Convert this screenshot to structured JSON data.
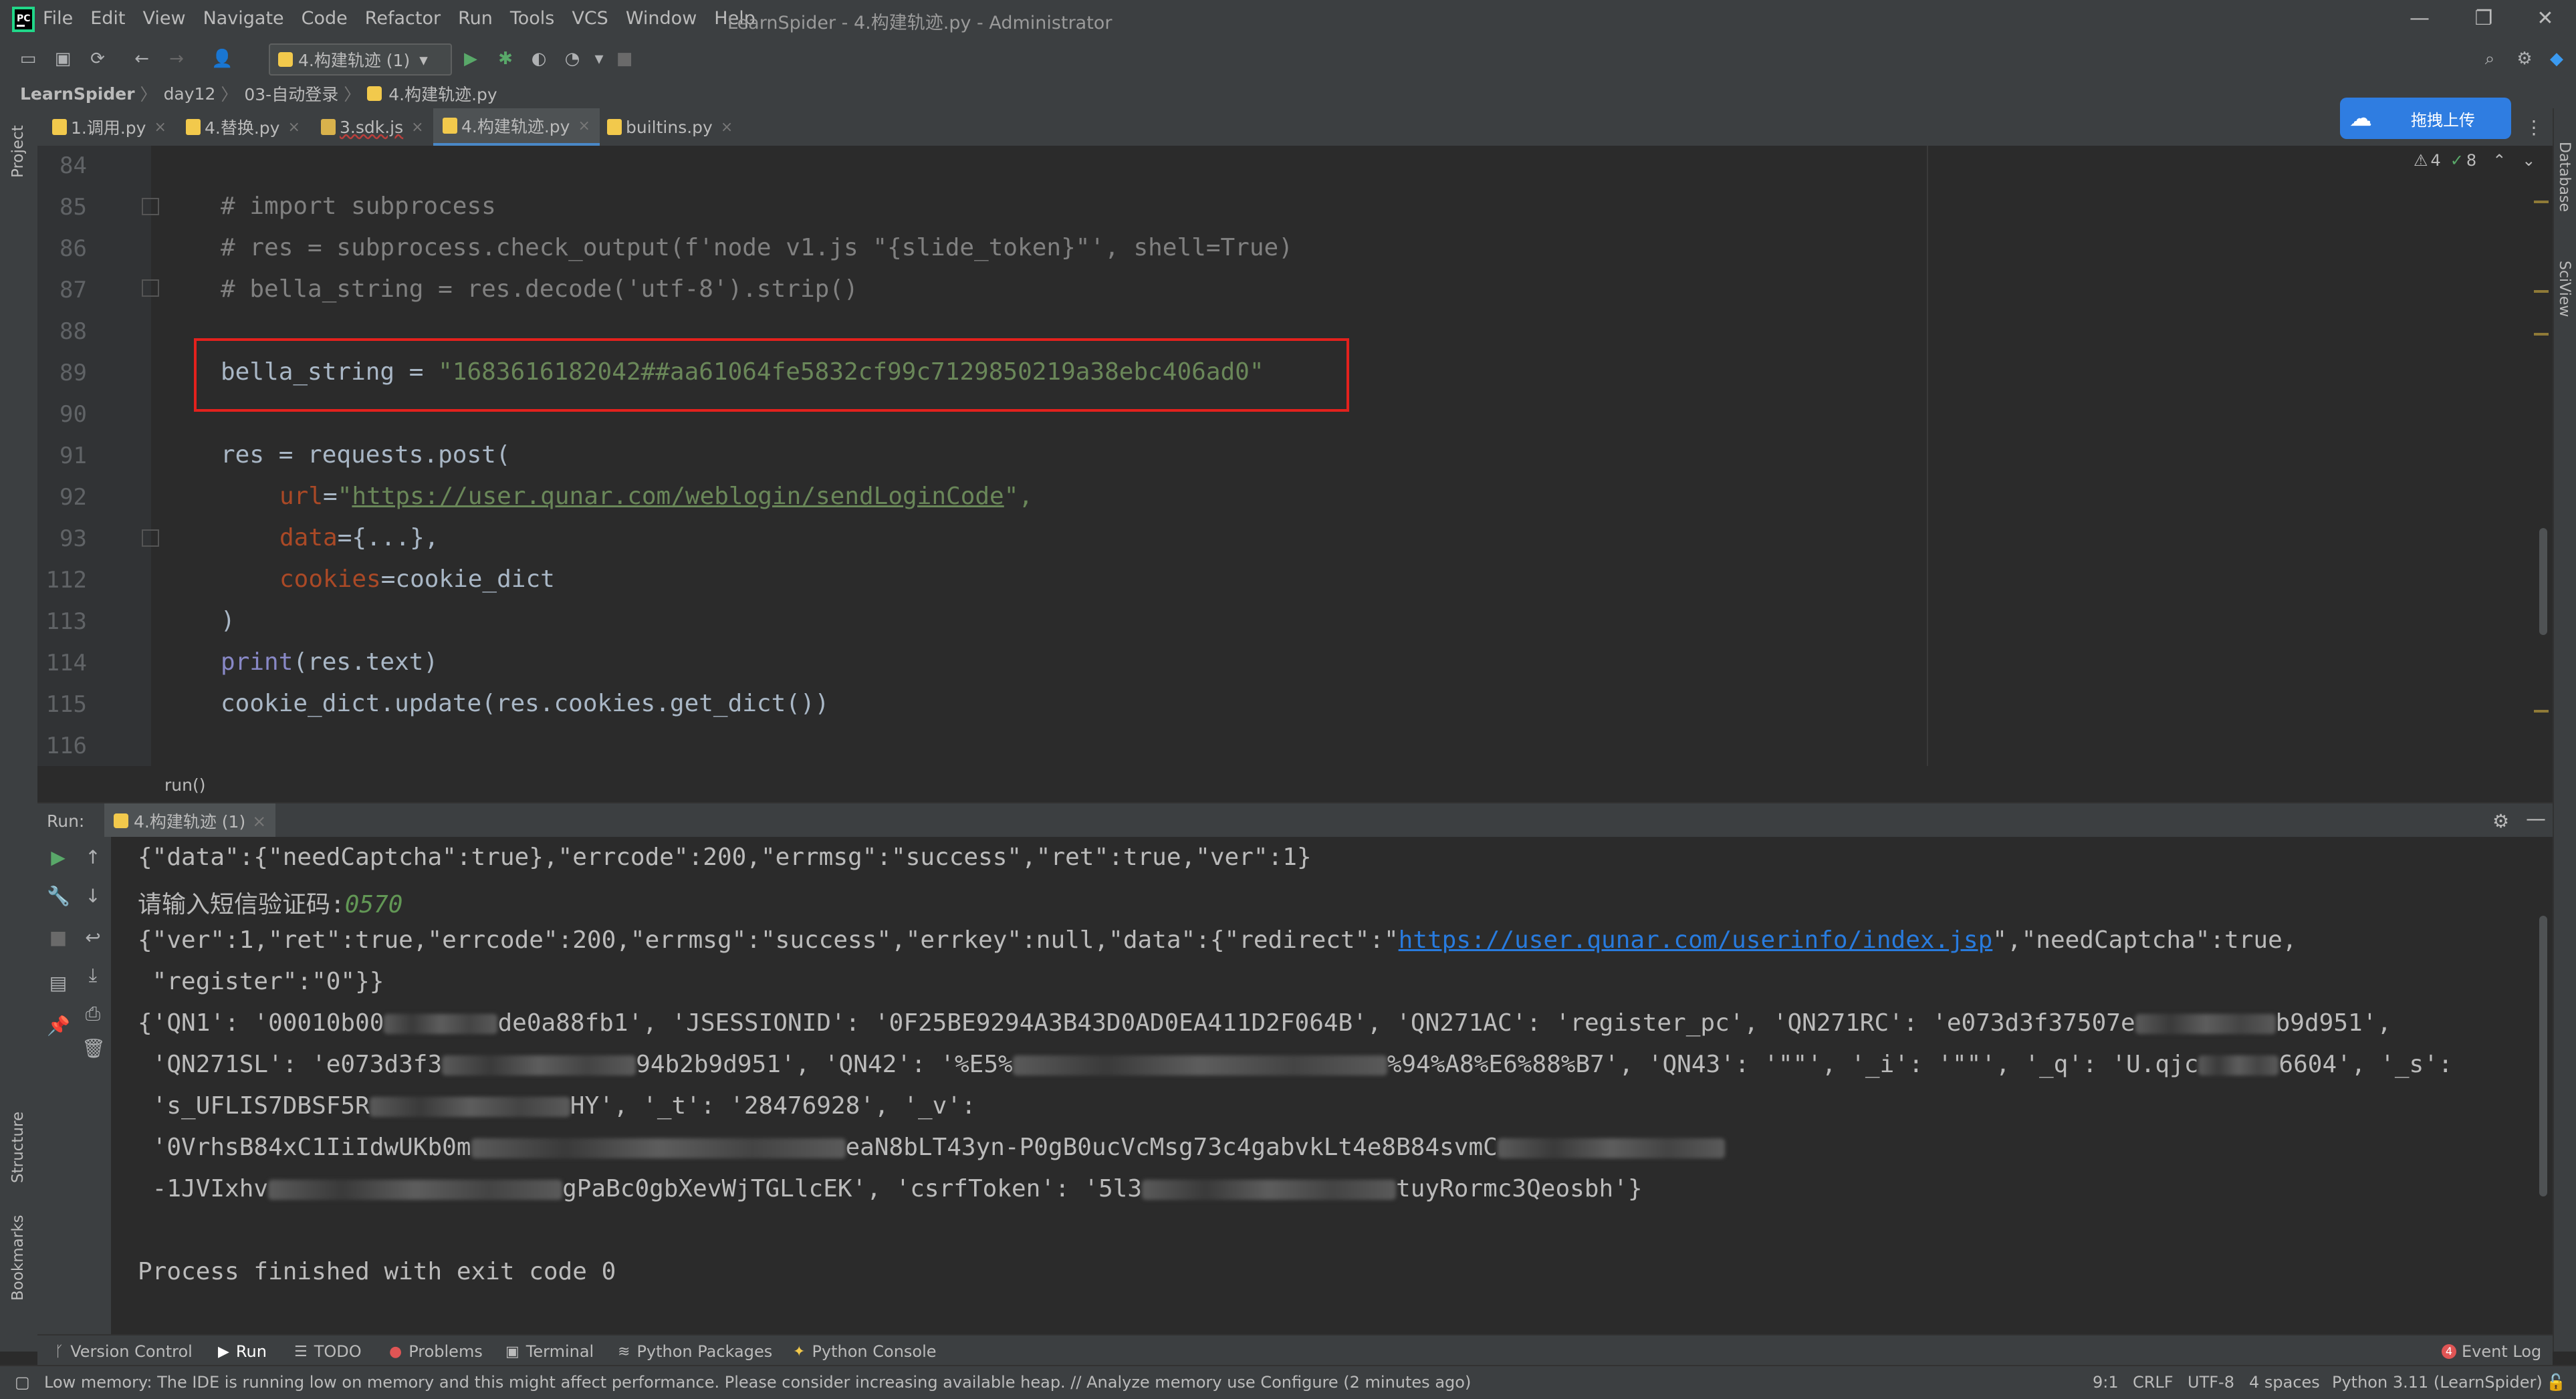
{
  "app": {
    "menu": [
      "File",
      "Edit",
      "View",
      "Navigate",
      "Code",
      "Refactor",
      "Run",
      "Tools",
      "VCS",
      "Window",
      "Help"
    ],
    "window_title": "LearnSpider - 4.构建轨迹.py - Administrator",
    "window_controls": [
      "—",
      "❐",
      "✕"
    ]
  },
  "toolbar": {
    "run_config": "4.构建轨迹 (1)"
  },
  "breadcrumb": [
    "LearnSpider",
    "day12",
    "03-自动登录",
    "4.构建轨迹.py"
  ],
  "side_labels": {
    "project": "Project",
    "structure": "Structure",
    "bookmarks": "Bookmarks",
    "database": "Database",
    "sciview": "SciView"
  },
  "tabs": [
    {
      "label": "1.调用.py",
      "icon_color": "#f2c94c"
    },
    {
      "label": "4.替换.py",
      "icon_color": "#f2c94c"
    },
    {
      "label": "3.sdk.js",
      "icon_color": "#d9b24c"
    },
    {
      "label": "4.构建轨迹.py",
      "icon_color": "#f2c94c"
    },
    {
      "label": "builtins.py",
      "icon_color": "#f2c94c"
    }
  ],
  "baidu_widget": {
    "label": "拖拽上传"
  },
  "inspections": {
    "warnings": "4",
    "ok": "8"
  },
  "editor": {
    "line_numbers": [
      "84",
      "85",
      "86",
      "87",
      "88",
      "89",
      "90",
      "91",
      "92",
      "93",
      "112",
      "113",
      "114",
      "115",
      "116"
    ],
    "lines": {
      "l85": "# import subprocess",
      "l86": "# res = subprocess.check_output(f'node v1.js \"{slide_token}\"', shell=True)",
      "l87": "# bella_string = res.decode('utf-8').strip()",
      "l89_var": "bella_string = ",
      "l89_str": "\"1683616182042##aa61064fe5832cf99c7129850219a38ebc406ad0\"",
      "l91": "res = requests.post(",
      "l92_param": "url",
      "l92_eq": "=",
      "l92_q1": "\"",
      "l92_url": "https://user.qunar.com/weblogin/sendLoginCode",
      "l92_q2": "\",",
      "l93_param": "data",
      "l93_rest": "={...},",
      "l112_param": "cookies",
      "l112_rest": "=cookie_dict",
      "l113": ")",
      "l114_fn": "print",
      "l114_rest": "(res.text)",
      "l115": "cookie_dict.update(res.cookies.get_dict())"
    },
    "bottom_crumb": "run()"
  },
  "run": {
    "label": "Run:",
    "tab": "4.构建轨迹 (1)",
    "output": {
      "o1": "{\"data\":{\"needCaptcha\":true},\"errcode\":200,\"errmsg\":\"success\",\"ret\":true,\"ver\":1}",
      "o2_prompt": "请输入短信验证码:",
      "o2_input": "0570",
      "o3_a": "{\"ver\":1,\"ret\":true,\"errcode\":200,\"errmsg\":\"success\",\"errkey\":null,\"data\":{\"redirect\":\"",
      "o3_link": "https://user.qunar.com/userinfo/index.jsp",
      "o3_b": "\",\"needCaptcha\":true,",
      "o4": " \"register\":\"0\"}}",
      "o5_a": "{'QN1': '00010b00",
      "o5_b": "de0a88fb1', 'JSESSIONID': '0F25BE9294A3B43D0AD0EA411D2F064B', 'QN271AC': 'register_pc', 'QN271RC': 'e073d3f37507e",
      "o5_c": "b9d951',",
      "o6_a": " 'QN271SL': 'e073d3f3",
      "o6_b": "94b2b9d951', 'QN42': '%E5%",
      "o6_c": "%94%A8%E6%88%B7', 'QN43': '\"\"', '_i': '\"\"', '_q': 'U.qjc",
      "o6_d": "6604', '_s':",
      "o7_a": " 's_UFLIS7DBSF5R",
      "o7_b": "HY', '_t': '28476928', '_v':",
      "o8_a": " '0VrhsB84xC1IiIdwUKb0m",
      "o8_b": "eaN8bLT43yn-P0gB0ucVcMsg73c4gabvkLt4e8B84svmC",
      "o9_a": " -1JVIxhv",
      "o9_b": "gPaBc0gbXevWjTGLlcEK', 'csrfToken': '5l3",
      "o9_c": "tuyRormc3Qeosbh'}",
      "o10": "Process finished with exit code 0"
    }
  },
  "tool_tabs": [
    {
      "label": "Version Control",
      "icon": "branch-icon"
    },
    {
      "label": "Run",
      "icon": "play-icon"
    },
    {
      "label": "TODO",
      "icon": "list-icon"
    },
    {
      "label": "Problems",
      "icon": "problems-icon"
    },
    {
      "label": "Terminal",
      "icon": "terminal-icon"
    },
    {
      "label": "Python Packages",
      "icon": "layers-icon"
    },
    {
      "label": "Python Console",
      "icon": "python-icon"
    }
  ],
  "event_log": {
    "count": "4",
    "label": "Event Log"
  },
  "status": {
    "message": "Low memory: The IDE is running low on memory and this might affect performance. Please consider increasing available heap. // Analyze memory use   Configure (2 minutes ago)",
    "position": "9:1",
    "line_sep": "CRLF",
    "encoding": "UTF-8",
    "indent": "4 spaces",
    "interpreter": "Python 3.11 (LearnSpider)"
  },
  "colors": {
    "highlight_box": "#e3211d",
    "accent": "#4a88c7",
    "string": "#6a8759",
    "keyword_param": "#aa4926",
    "link": "#287bde",
    "input": "#629755"
  }
}
